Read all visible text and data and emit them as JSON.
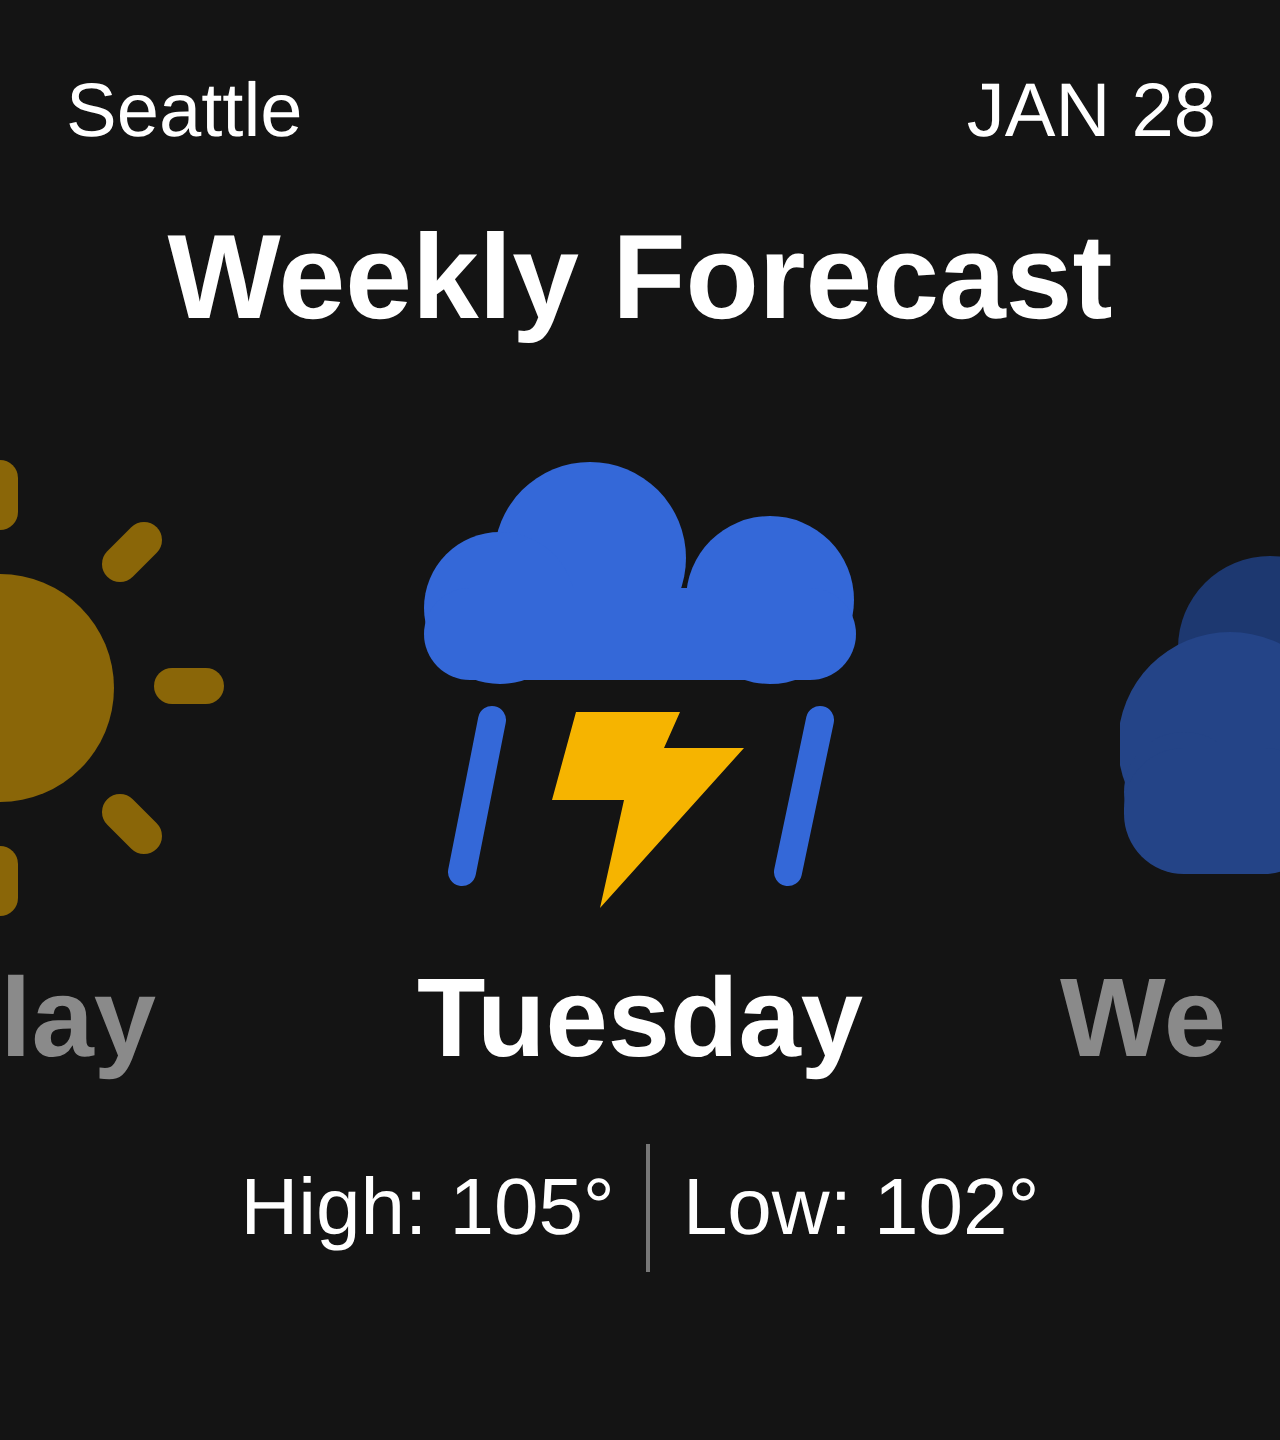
{
  "header": {
    "location": "Seattle",
    "date": "JAN 28"
  },
  "title": "Weekly Forecast",
  "days": [
    {
      "label": "lay",
      "kind": "sun",
      "selected": false
    },
    {
      "label": "Tuesday",
      "kind": "storm",
      "selected": true
    },
    {
      "label": "We",
      "kind": "cloud",
      "selected": false
    }
  ],
  "temps": {
    "high": "High: 105°",
    "low": "Low: 102°"
  }
}
